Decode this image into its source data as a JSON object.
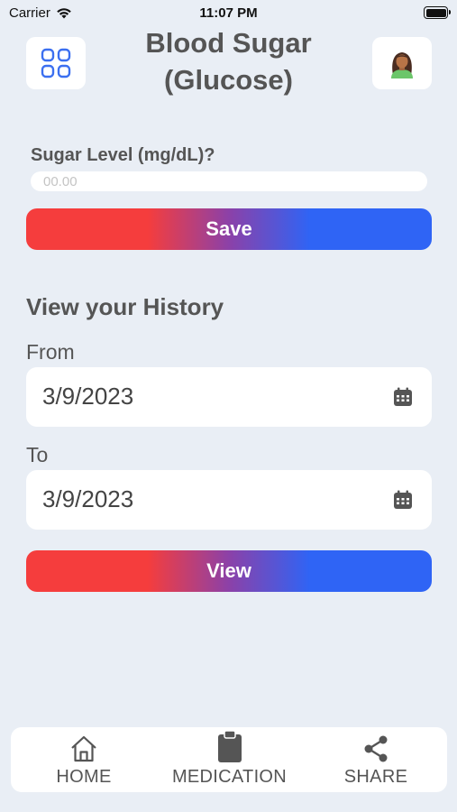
{
  "status_bar": {
    "carrier": "Carrier",
    "time": "11:07 PM"
  },
  "header": {
    "title_line1": "Blood Sugar",
    "title_line2": "(Glucose)",
    "menu_icon": "grid-menu-icon",
    "avatar_icon": "user-avatar-icon",
    "accent_color": "#3b6ff0"
  },
  "entry": {
    "label": "Sugar Level (mg/dL)?",
    "placeholder": "00.00",
    "save_label": "Save"
  },
  "history": {
    "title": "View your History",
    "from_label": "From",
    "from_value": "3/9/2023",
    "to_label": "To",
    "to_value": "3/9/2023",
    "view_label": "View",
    "calendar_icon": "calendar-icon"
  },
  "button_gradient": {
    "left": "#f53d3d",
    "right": "#2f64f5"
  },
  "tabs": [
    {
      "label": "HOME",
      "icon": "home-icon"
    },
    {
      "label": "MEDICATION",
      "icon": "clipboard-icon"
    },
    {
      "label": "SHARE",
      "icon": "share-icon"
    }
  ]
}
